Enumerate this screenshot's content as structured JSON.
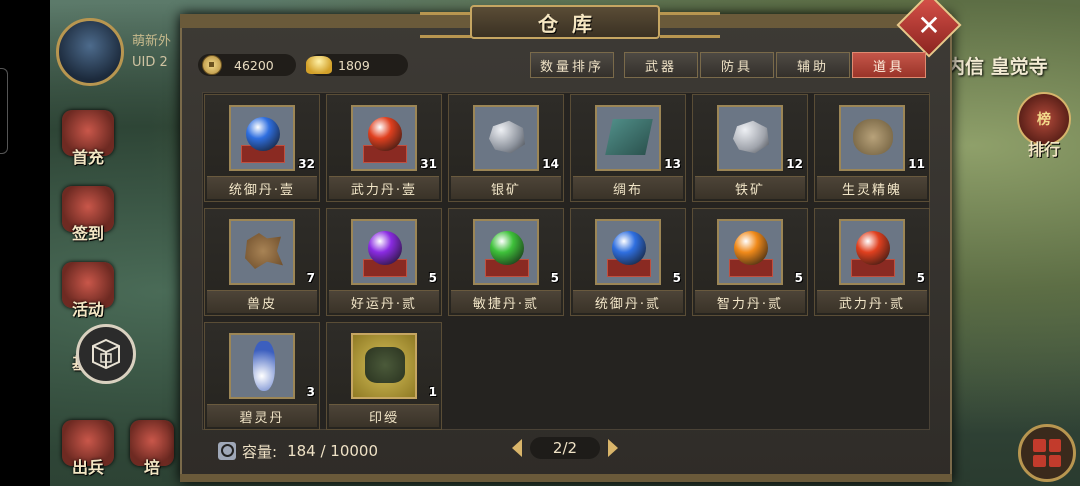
{
  "hud": {
    "player_name": "萌新外",
    "uid_label": "UID",
    "uid_value": "2",
    "right_banner": "内信 皇觉寺",
    "side_buttons": [
      {
        "label": "首充"
      },
      {
        "label": "签到"
      },
      {
        "label": "活动"
      },
      {
        "label": "基"
      },
      {
        "label": "出兵"
      },
      {
        "label": "培"
      }
    ],
    "rank_label": "排行",
    "rank_badge": "榜"
  },
  "panel": {
    "title": "仓库",
    "close_icon": "✕",
    "currency": [
      {
        "icon": "copper-coin-icon",
        "value": "46200"
      },
      {
        "icon": "gold-ingot-icon",
        "value": "1809"
      }
    ],
    "sort_button": "数量排序",
    "tabs": [
      {
        "label": "武器",
        "active": false
      },
      {
        "label": "防具",
        "active": false
      },
      {
        "label": "辅助",
        "active": false
      },
      {
        "label": "道具",
        "active": true
      }
    ],
    "items": [
      {
        "name": "统御丹·壹",
        "count": "32",
        "kind": "orb",
        "color": "#2f6fe0"
      },
      {
        "name": "武力丹·壹",
        "count": "31",
        "kind": "orb",
        "color": "#e0401f"
      },
      {
        "name": "银矿",
        "count": "14",
        "kind": "ore",
        "color": "#8c929c"
      },
      {
        "name": "绸布",
        "count": "13",
        "kind": "cloth",
        "color": "#4f8c86"
      },
      {
        "name": "铁矿",
        "count": "12",
        "kind": "ore",
        "color": "#a0a4ac"
      },
      {
        "name": "生灵精魄",
        "count": "11",
        "kind": "mask",
        "color": "#b8a27a"
      },
      {
        "name": "兽皮",
        "count": "7",
        "kind": "hide",
        "color": "#a88355"
      },
      {
        "name": "好运丹·贰",
        "count": "5",
        "kind": "orb",
        "color": "#8a2be2"
      },
      {
        "name": "敏捷丹·贰",
        "count": "5",
        "kind": "orb",
        "color": "#3ec13a"
      },
      {
        "name": "统御丹·贰",
        "count": "5",
        "kind": "orb",
        "color": "#2f6fe0"
      },
      {
        "name": "智力丹·贰",
        "count": "5",
        "kind": "orb",
        "color": "#f08a1a"
      },
      {
        "name": "武力丹·贰",
        "count": "5",
        "kind": "orb",
        "color": "#e0401f"
      },
      {
        "name": "碧灵丹",
        "count": "3",
        "kind": "vase",
        "color": "#3c5fbf"
      },
      {
        "name": "印绶",
        "count": "1",
        "kind": "seal",
        "color": "#4b5a3a"
      }
    ],
    "capacity_label": "容量:",
    "capacity_value": "184 / 10000",
    "page": "2/2"
  }
}
